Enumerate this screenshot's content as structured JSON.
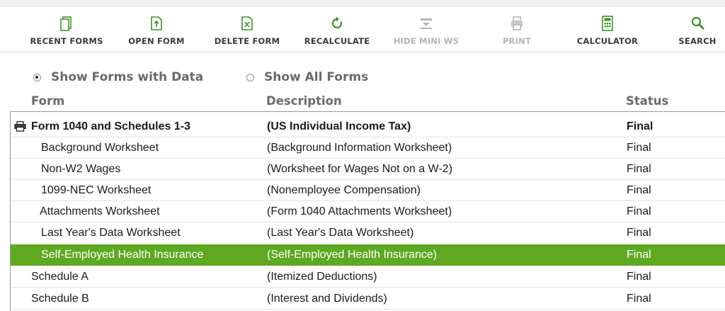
{
  "toolbar": {
    "recent_forms": "RECENT FORMS",
    "open_form": "OPEN FORM",
    "delete_form": "DELETE FORM",
    "recalculate": "RECALCULATE",
    "hide_mini_ws": "HIDE MINI WS",
    "print": "PRINT",
    "calculator": "CALCULATOR",
    "search": "SEARCH"
  },
  "filter": {
    "with_data": "Show Forms with Data",
    "all_forms": "Show All Forms",
    "selected": "with_data"
  },
  "columns": {
    "form": "Form",
    "description": "Description",
    "status": "Status"
  },
  "rows": [
    {
      "form": "Form 1040 and Schedules 1-3",
      "description": "(US Individual Income Tax)",
      "status": "Final"
    },
    {
      "form": "Background Worksheet",
      "description": "(Background Information Worksheet)",
      "status": "Final"
    },
    {
      "form": "Non-W2 Wages",
      "description": "(Worksheet for Wages Not on a W-2)",
      "status": "Final"
    },
    {
      "form": "1099-NEC Worksheet",
      "description": "(Nonemployee Compensation)",
      "status": "Final"
    },
    {
      "form": "Attachments Worksheet",
      "description": "(Form 1040 Attachments Worksheet)",
      "status": "Final"
    },
    {
      "form": "Last Year's Data Worksheet",
      "description": "(Last Year's Data Worksheet)",
      "status": "Final"
    },
    {
      "form": "Self-Employed Health Insurance",
      "description": "(Self-Employed Health Insurance)",
      "status": "Final"
    },
    {
      "form": "Schedule A",
      "description": "(Itemized Deductions)",
      "status": "Final"
    },
    {
      "form": "Schedule B",
      "description": "(Interest and Dividends)",
      "status": "Final"
    }
  ],
  "colors": {
    "icon_green": "#3f8f2a",
    "selected_row": "#5fa821",
    "disabled": "#b4b4b4"
  }
}
